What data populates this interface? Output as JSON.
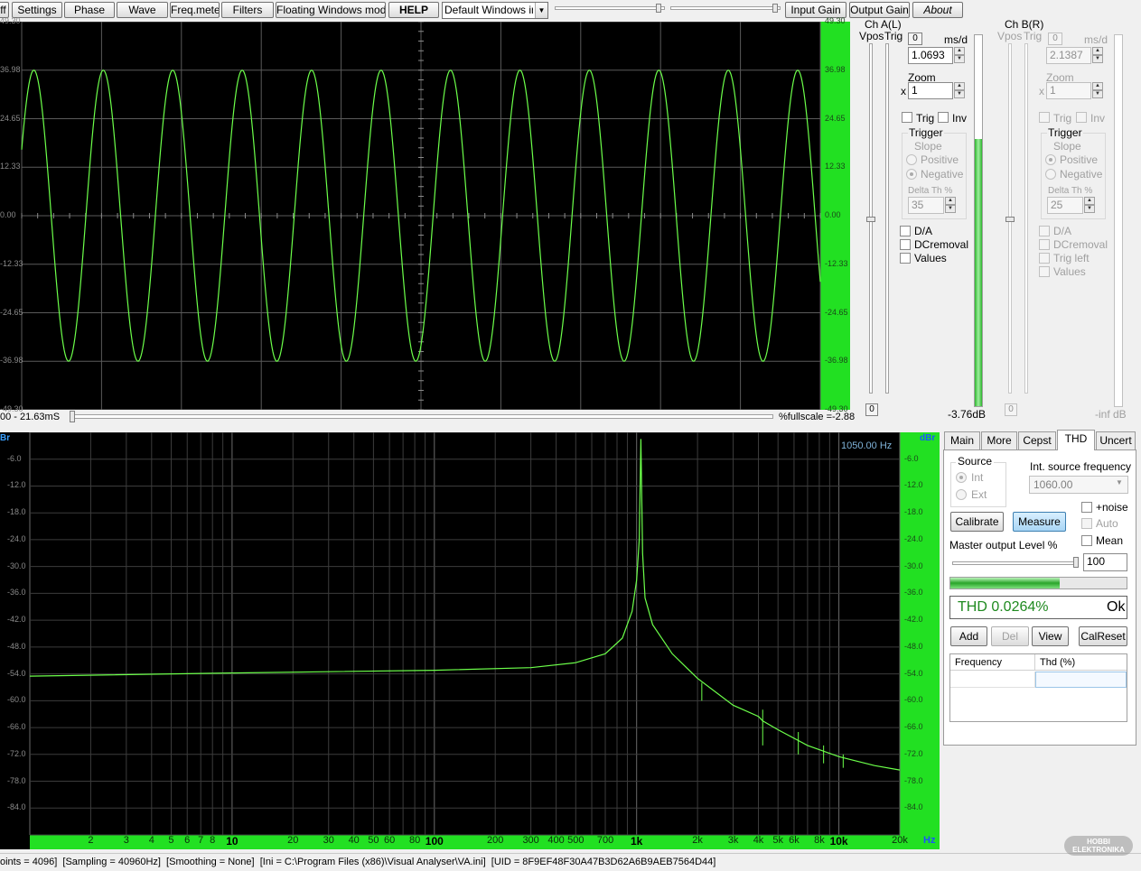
{
  "toolbar": {
    "off_label": "ff",
    "settings": "Settings",
    "phase": "Phase",
    "wave": "Wave",
    "freqmeter": "Freq.meter",
    "filters": "Filters",
    "floating": "Floating Windows mode",
    "help": "HELP",
    "device": "Default Windows inp",
    "input_gain": "Input Gain",
    "output_gain": "Output Gain",
    "about": "About"
  },
  "scope": {
    "y_labels_left": [
      "49.30",
      "36.98",
      "24.65",
      "12.33",
      "0.00",
      "-12.33",
      "-24.65",
      "-36.98",
      "-49.30"
    ],
    "y_labels_right": [
      "49.30",
      "36.98",
      "24.65",
      "12.33",
      "0.00",
      "-12.33",
      "-24.65",
      "-36.98",
      "-49.30"
    ],
    "time_range": "00 - 21.63mS",
    "fullscale": "%fullscale =-2.88",
    "cycles": 11.5,
    "amplitude_pct_fullscale": 0.75
  },
  "chA": {
    "title": "Ch A(L)",
    "vpos": "Vpos",
    "trig": "Trig",
    "ms_btn": "0",
    "msd_label": "ms/d",
    "msd_value": "1.0693",
    "zoom_label": "Zoom",
    "zoom_x": "x",
    "zoom_value": "1",
    "trig_chk": "Trig",
    "inv_chk": "Inv",
    "trigger_label": "Trigger",
    "slope_label": "Slope",
    "positive": "Positive",
    "negative": "Negative",
    "delta_label": "Delta Th %",
    "delta_value": "35",
    "da": "D/A",
    "dcremoval": "DCremoval",
    "values": "Values",
    "zero_btn": "0",
    "level": "-3.76dB",
    "meter_level_pct": 0.72
  },
  "chB": {
    "title": "Ch B(R)",
    "vpos": "Vpos",
    "trig": "Trig",
    "ms_btn": "0",
    "msd_label": "ms/d",
    "msd_value": "2.1387",
    "zoom_label": "Zoom",
    "zoom_x": "x",
    "zoom_value": "1",
    "trig_chk": "Trig",
    "inv_chk": "Inv",
    "trigger_label": "Trigger",
    "slope_label": "Slope",
    "positive": "Positive",
    "negative": "Negative",
    "delta_label": "Delta Th %",
    "delta_value": "25",
    "da": "D/A",
    "dcremoval": "DCremoval",
    "trig_left": "Trig left",
    "values": "Values",
    "zero_btn": "0",
    "level": "-inf dB"
  },
  "spectrum": {
    "unit_left": "Br",
    "unit_right": "dBr",
    "unit_hz": "Hz",
    "peak_readout": "1050.00 Hz",
    "y_labels": [
      "-6.0",
      "-12.0",
      "-18.0",
      "-24.0",
      "-30.0",
      "-36.0",
      "-42.0",
      "-48.0",
      "-54.0",
      "-60.0",
      "-66.0",
      "-72.0",
      "-78.0",
      "-84.0"
    ],
    "x_labels": [
      "2",
      "3",
      "4",
      "5",
      "6",
      "7",
      "8",
      "10",
      "20",
      "30",
      "40",
      "50",
      "60",
      "80",
      "100",
      "200",
      "300",
      "400",
      "500",
      "700",
      "1k",
      "2k",
      "3k",
      "4k",
      "5k",
      "6k",
      "8k",
      "10k",
      "20k"
    ]
  },
  "chart_data": {
    "type": "line",
    "title": "",
    "xlabel": "Hz",
    "ylabel": "dBr",
    "x_scale": "log",
    "xlim": [
      1,
      20000
    ],
    "ylim": [
      -90,
      0
    ],
    "grid": true,
    "series": [
      {
        "x": [
          1,
          10,
          100,
          300,
          500,
          700,
          850,
          950,
          1000,
          1030,
          1050,
          1070,
          1100,
          1200,
          1500,
          2000,
          3000,
          4000,
          4200,
          5000,
          7000,
          10000,
          15000,
          20000
        ],
        "values": [
          -54.5,
          -53.8,
          -53.2,
          -52.6,
          -51.5,
          -49.5,
          -46,
          -40,
          -33,
          -24,
          -1.5,
          -27,
          -37,
          -43,
          -49.5,
          -55,
          -61,
          -63.5,
          -64.5,
          -66.5,
          -70,
          -72.5,
          -74.5,
          -75.5
        ]
      }
    ]
  },
  "thd": {
    "tabs": [
      "Main",
      "More",
      "Cepst",
      "THD",
      "Uncert"
    ],
    "active_tab": "THD",
    "source_label": "Source",
    "int": "Int",
    "ext": "Ext",
    "int_freq_label": "Int. source frequency",
    "int_freq_value": "1060.00",
    "plus_noise": "+noise",
    "auto": "Auto",
    "mean": "Mean",
    "calibrate": "Calibrate",
    "measure": "Measure",
    "master_label": "Master output Level %",
    "master_value": "100",
    "master_level_pct": 0.62,
    "thd_readout": "THD 0.0264%",
    "ok": "Ok",
    "add": "Add",
    "del": "Del",
    "view": "View",
    "calreset": "CalReset",
    "col_frequency": "Frequency",
    "col_thd": "Thd (%)"
  },
  "status_bar": "oints = 4096]  [Sampling = 40960Hz]  [Smoothing = None]  [Ini = C:\\Program Files (x86)\\Visual Analyser\\VA.ini]  [UID = 8F9EF48F30A47B3D62A6B9AEB7564D44]",
  "watermark": "HOBBI ELEKTRONIKA"
}
